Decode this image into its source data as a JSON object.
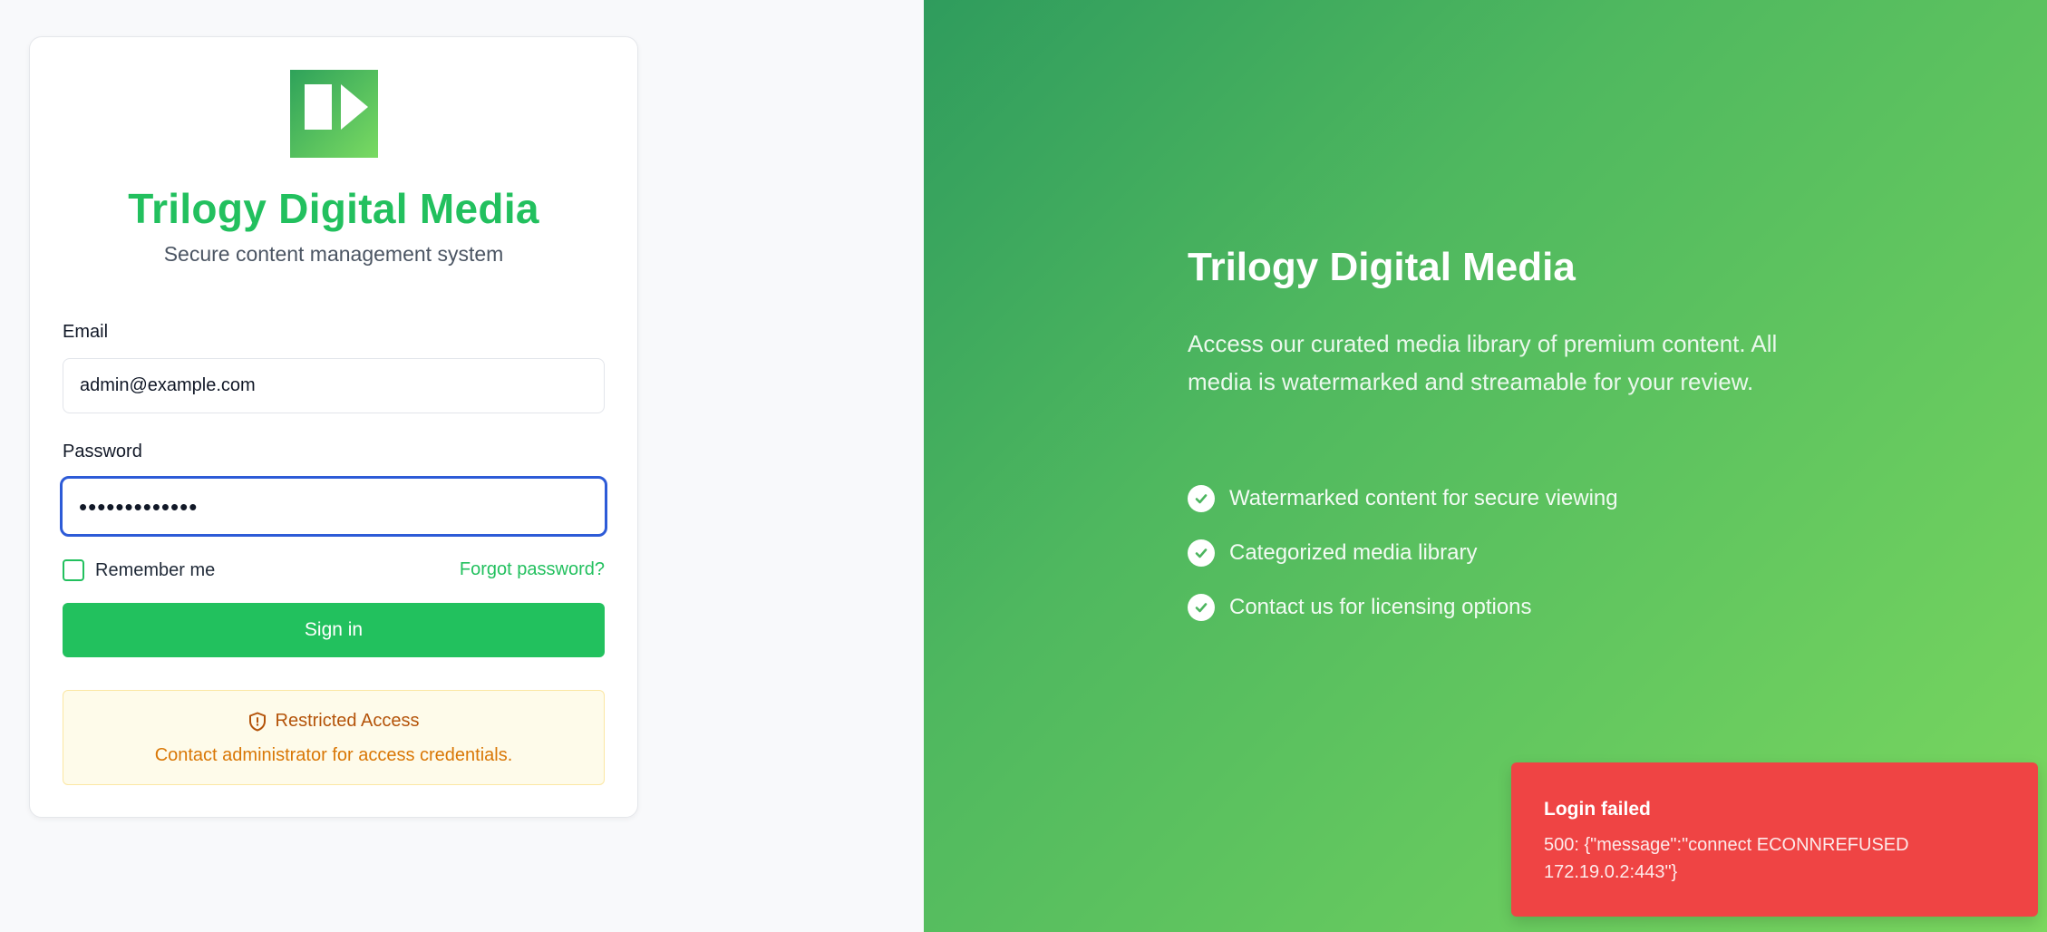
{
  "brand": {
    "name": "Trilogy Digital Media",
    "subtitle": "Secure content management system",
    "accent_color": "#22c05e"
  },
  "login_form": {
    "email_label": "Email",
    "email_value": "admin@example.com",
    "password_label": "Password",
    "password_masked": "•••••••••••••",
    "remember_label": "Remember me",
    "remember_checked": false,
    "forgot_link": "Forgot password?",
    "signin_button": "Sign in"
  },
  "notice": {
    "icon": "shield-alert-icon",
    "title": "Restricted Access",
    "text": "Contact administrator for access credentials."
  },
  "hero": {
    "title": "Trilogy Digital Media",
    "description": "Access our curated media library of premium content. All media is watermarked and streamable for your review.",
    "features": [
      {
        "icon": "check-circle-icon",
        "text": "Watermarked content for secure viewing"
      },
      {
        "icon": "check-circle-icon",
        "text": "Categorized media library"
      },
      {
        "icon": "check-circle-icon",
        "text": "Contact us for licensing options"
      }
    ]
  },
  "toast": {
    "title": "Login failed",
    "message": "500: {\"message\":\"connect ECONNREFUSED 172.19.0.2:443\"}",
    "color": "#ef4444"
  }
}
